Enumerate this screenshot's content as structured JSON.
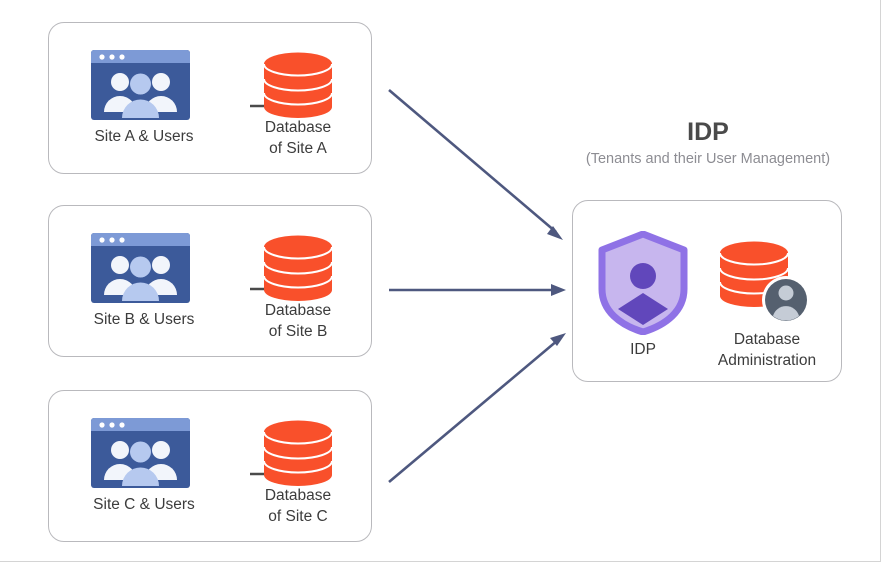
{
  "diagram": {
    "title": "IDP",
    "subtitle": "(Tenants and their User Management)",
    "colors": {
      "database_orange": "#f9502b",
      "browser_blue": "#3c5a9a",
      "browser_titlebar_blue": "#7d9ad6",
      "shield_fill": "#c7b6ee",
      "shield_border": "#8f72e6",
      "shield_person": "#6147bb",
      "connector_arrow": "#4e587f",
      "inner_arrow": "#4a4a4a",
      "box_border": "#b9b9bd",
      "label_text": "#3c3c3c",
      "subtitle_text": "#8d8d93",
      "avatar_circle": "#55606f",
      "avatar_person": "#c5ccd6"
    },
    "site_groups": [
      {
        "id": "a",
        "site_label": "Site A & Users",
        "database_label": "Database\nof Site A",
        "database_label_line1": "Database",
        "database_label_line2": "of Site A",
        "browser_icon": "site-users-icon",
        "database_icon": "database-icon",
        "inner_arrow_icon": "arrow-right-icon"
      },
      {
        "id": "b",
        "site_label": "Site B & Users",
        "database_label": "Database\nof Site B",
        "database_label_line1": "Database",
        "database_label_line2": "of Site B",
        "browser_icon": "site-users-icon",
        "database_icon": "database-icon",
        "inner_arrow_icon": "arrow-right-icon"
      },
      {
        "id": "c",
        "site_label": "Site C & Users",
        "database_label": "Database\nof Site C",
        "database_label_line1": "Database",
        "database_label_line2": "of Site C",
        "browser_icon": "site-users-icon",
        "database_icon": "database-icon",
        "inner_arrow_icon": "arrow-right-icon"
      }
    ],
    "idp_box": {
      "shield_label": "IDP",
      "shield_icon": "shield-user-icon",
      "db_admin_label_line1": "Database",
      "db_admin_label_line2": "Administration",
      "db_admin_icon": "database-admin-icon"
    },
    "connectors": [
      {
        "from": "site-group-a",
        "to": "idp-group",
        "icon": "arrow-diagonal-down-icon"
      },
      {
        "from": "site-group-b",
        "to": "idp-group",
        "icon": "arrow-right-icon"
      },
      {
        "from": "site-group-c",
        "to": "idp-group",
        "icon": "arrow-diagonal-up-icon"
      }
    ]
  }
}
